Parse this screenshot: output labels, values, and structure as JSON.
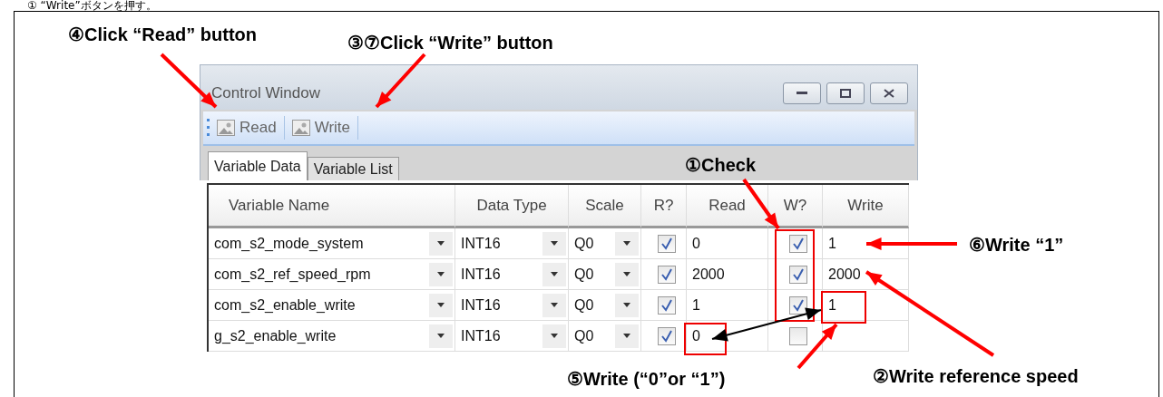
{
  "page_heading": "① “Write”ボタンを押す。",
  "window": {
    "title": "Control Window",
    "toolbar": [
      {
        "label": "Read"
      },
      {
        "label": "Write"
      }
    ],
    "tabs": [
      {
        "label": "Variable Data",
        "selected": true
      },
      {
        "label": "Variable List",
        "selected": false
      }
    ]
  },
  "table": {
    "columns": [
      "Variable Name",
      "Data Type",
      "Scale",
      "R?",
      "Read",
      "W?",
      "Write"
    ],
    "rows": [
      {
        "name": "com_s2_mode_system",
        "type": "INT16",
        "scale": "Q0",
        "read_checked": true,
        "read": "0",
        "write_checked": true,
        "write": "1"
      },
      {
        "name": "com_s2_ref_speed_rpm",
        "type": "INT16",
        "scale": "Q0",
        "read_checked": true,
        "read": "2000",
        "write_checked": true,
        "write": "2000"
      },
      {
        "name": "com_s2_enable_write",
        "type": "INT16",
        "scale": "Q0",
        "read_checked": true,
        "read": "1",
        "write_checked": true,
        "write": "1"
      },
      {
        "name": "g_s2_enable_write",
        "type": "INT16",
        "scale": "Q0",
        "read_checked": true,
        "read": "0",
        "write_checked": false,
        "write": ""
      }
    ]
  },
  "annotations": [
    "④Click “Read” button",
    "③⑦Click “Write” button",
    "①Check",
    "⑥Write “1”",
    "⑤Write (“0”or “1”)",
    "②Write reference speed"
  ]
}
